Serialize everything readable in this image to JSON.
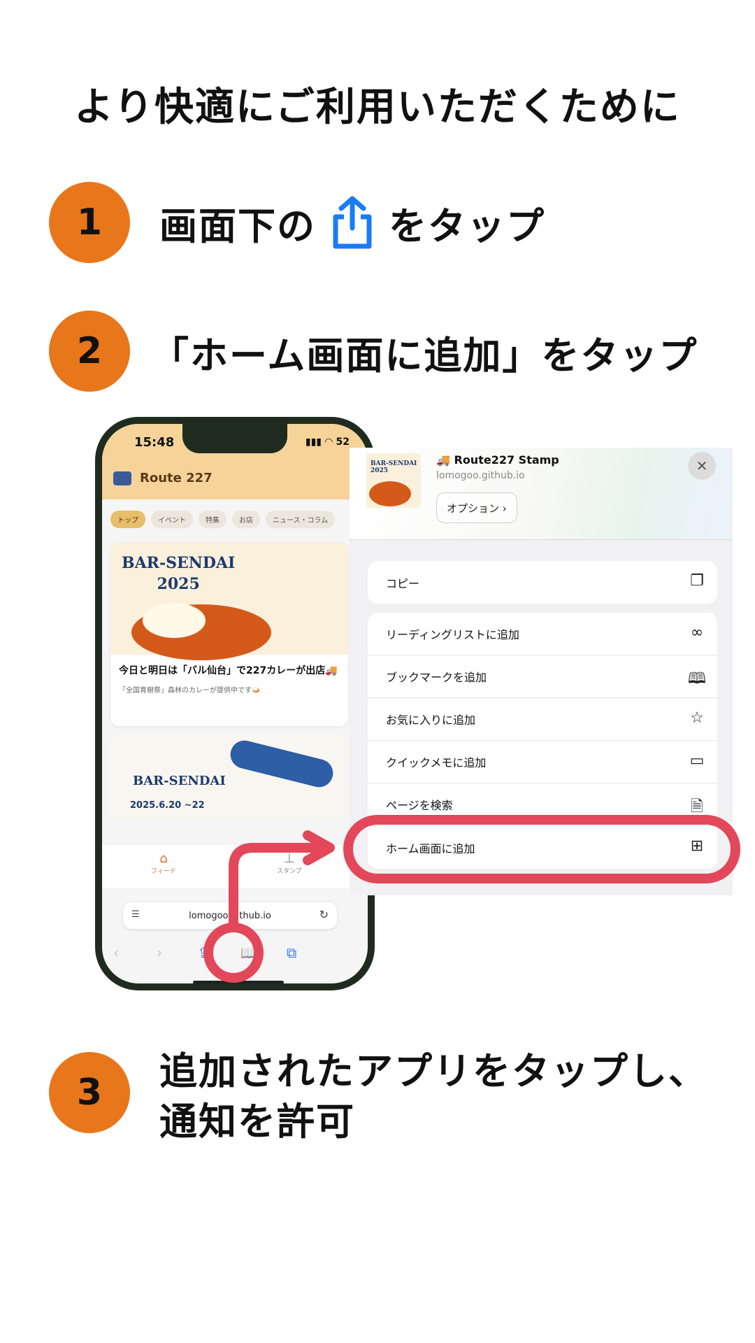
{
  "title": "より快適にご利用いただくために",
  "steps": [
    {
      "number": "1",
      "before_icon": "画面下の",
      "icon": "share-icon",
      "after_icon": "をタップ"
    },
    {
      "number": "2",
      "text": "「ホーム画面に追加」をタップ"
    },
    {
      "number": "3",
      "line1": "追加されたアプリをタップし、",
      "line2": "通知を許可"
    }
  ],
  "colors": {
    "step_circle": "#e8761b",
    "highlight": "#e2475a",
    "share_blue": "#1a7cf5"
  },
  "phone": {
    "status_time": "15:48",
    "status_icons": "▮▮▮ ◠ 52",
    "app_name": "Route 227",
    "tabs": [
      "トップ",
      "イベント",
      "特集",
      "お店",
      "ニュース・コラム"
    ],
    "card1": {
      "image_text": "BAR-SENDAI\n2025",
      "title": "今日と明日は「バル仙台」で227カレーが出店🚚",
      "subtitle": "「全国育樹祭」森林のカレーが提供中です🍛"
    },
    "card2": {
      "image_text": "BAR-SENDAI",
      "date": "2025.6.20 ~22"
    },
    "nav": {
      "feed": "フィード",
      "stamp": "スタンプ"
    },
    "url": "lomogoo.github.io"
  },
  "share_sheet": {
    "app_name": "🚚 Route227 Stamp",
    "domain": "lomogoo.github.io",
    "options_label": "オプション ›",
    "group1": [
      {
        "label": "コピー",
        "icon": "copy-icon"
      }
    ],
    "group2": [
      {
        "label": "リーディングリストに追加",
        "icon": "glasses-icon"
      },
      {
        "label": "ブックマークを追加",
        "icon": "book-icon"
      },
      {
        "label": "お気に入りに追加",
        "icon": "star-icon"
      },
      {
        "label": "クイックメモに追加",
        "icon": "quick-note-icon"
      },
      {
        "label": "ページを検索",
        "icon": "find-page-icon"
      },
      {
        "label": "ホーム画面に追加",
        "icon": "add-square-icon"
      }
    ]
  }
}
